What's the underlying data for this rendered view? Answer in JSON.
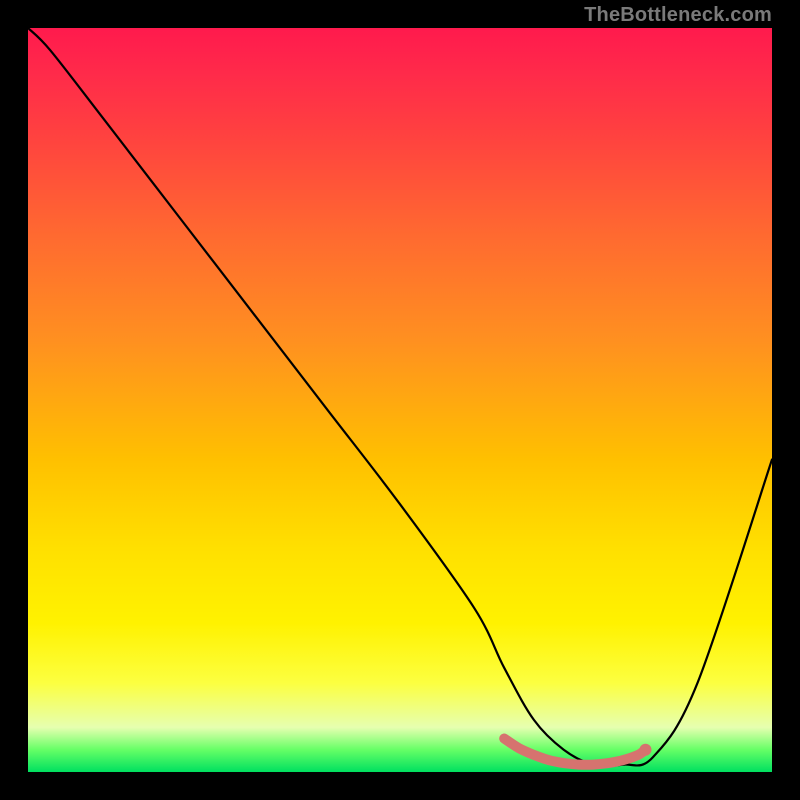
{
  "watermark": "TheBottleneck.com",
  "chart_data": {
    "type": "line",
    "title": "",
    "xlabel": "",
    "ylabel": "",
    "xlim": [
      0,
      100
    ],
    "ylim": [
      0,
      100
    ],
    "series": [
      {
        "name": "bottleneck-curve",
        "x": [
          0,
          3,
          10,
          20,
          30,
          40,
          50,
          60,
          64,
          68,
          72,
          76,
          80,
          84,
          90,
          100
        ],
        "y": [
          100,
          97,
          88,
          75,
          62,
          49,
          36,
          22,
          14,
          7,
          3,
          1,
          1,
          2,
          12,
          42
        ]
      },
      {
        "name": "highlight-band",
        "x": [
          64,
          66,
          68,
          70,
          72,
          74,
          76,
          78,
          80,
          82,
          83
        ],
        "y": [
          4.5,
          3.2,
          2.3,
          1.6,
          1.2,
          1.0,
          1.0,
          1.2,
          1.6,
          2.3,
          3.0
        ]
      }
    ],
    "colors": {
      "curve": "#000000",
      "highlight": "#d6736f",
      "gradient_top": "#ff1a4d",
      "gradient_mid": "#ffe000",
      "gradient_bottom": "#00e060"
    }
  }
}
